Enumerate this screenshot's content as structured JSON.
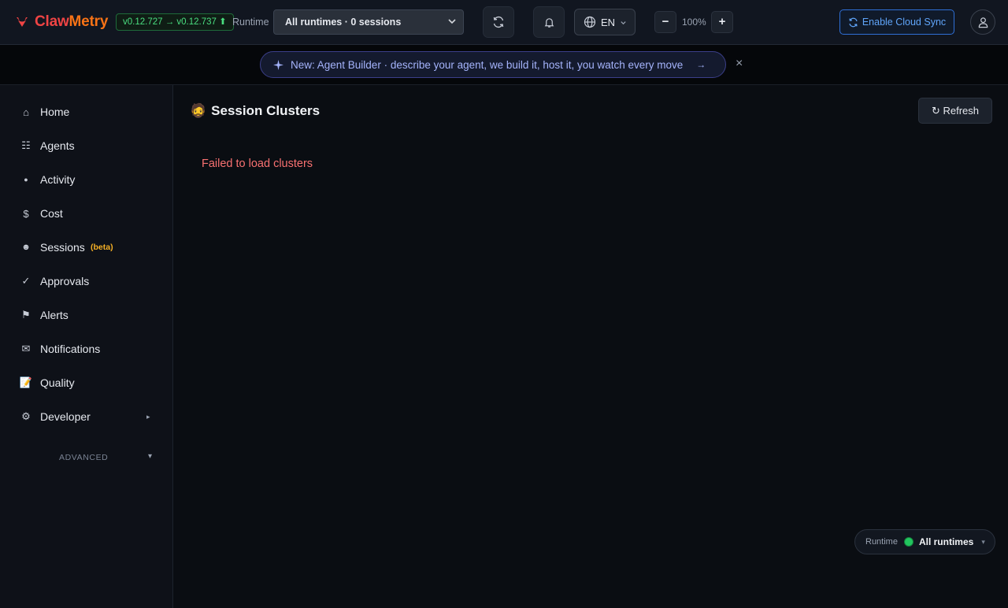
{
  "header": {
    "brand_part1": "Claw",
    "brand_part2": "Metry",
    "version": "v0.12.727 → v0.12.737 ⬆",
    "runtime_label": "Runtime",
    "runtime_selected": "All runtimes · 0 sessions",
    "language": "EN",
    "zoom_level": "100%",
    "zoom_out": "−",
    "zoom_in": "+",
    "cloud_sync_label": "Enable Cloud Sync"
  },
  "announcement": {
    "text": "New: Agent Builder · describe your agent, we build it, host it, you watch every move",
    "arrow": "→",
    "close": "×"
  },
  "sidebar": {
    "items": [
      {
        "label": "Home",
        "icon": "⌂"
      },
      {
        "label": "Agents",
        "icon": "☷"
      },
      {
        "label": "Activity",
        "icon": "●"
      },
      {
        "label": "Cost",
        "icon": "$"
      },
      {
        "label": "Sessions",
        "icon": "☻",
        "badge": "(beta)"
      },
      {
        "label": "Approvals",
        "icon": "✓"
      },
      {
        "label": "Alerts",
        "icon": "⚑"
      },
      {
        "label": "Notifications",
        "icon": "✉"
      },
      {
        "label": "Quality",
        "icon": "📝"
      },
      {
        "label": "Developer",
        "icon": "⚙",
        "caret": "▸"
      }
    ],
    "advanced_label": "ADVANCED",
    "advanced_caret": "▾"
  },
  "main": {
    "title_icon": "🧔",
    "title": "Session Clusters",
    "refresh_label": "↻ Refresh",
    "error": "Failed to load clusters"
  },
  "runtime_pill": {
    "label": "Runtime",
    "value": "All runtimes",
    "caret": "▾"
  },
  "colors": {
    "accent_red": "#ef4444",
    "accent_orange": "#f97316",
    "success_green": "#4ade80",
    "link_blue": "#60a5fa",
    "announce_indigo": "#a5b4fc",
    "error_red": "#f87171",
    "beta_amber": "#f5b025"
  }
}
